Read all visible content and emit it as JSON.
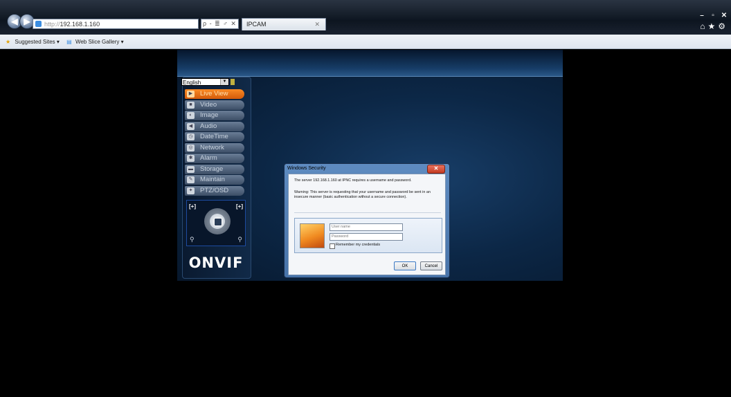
{
  "browser": {
    "address": "http://192.168.1.160",
    "address_protocol": "http://",
    "address_host": "192.168.1.160",
    "address_tools": "ρ - ≣ ♂ ✕",
    "tab_title": "IPCAM",
    "tab_close": "✕",
    "window_controls": [
      "–",
      "▫",
      "✕"
    ],
    "right_tools": "⌂★⚙",
    "favorites": {
      "suggested_sites": "Suggested Sites ▾",
      "web_slice_gallery": "Web Slice Gallery ▾"
    }
  },
  "camera_ui": {
    "language": "English",
    "menu": [
      {
        "label": "Live View",
        "icon": "play-icon",
        "active": true
      },
      {
        "label": "Video",
        "icon": "video-icon",
        "active": false
      },
      {
        "label": "Image",
        "icon": "image-icon",
        "active": false
      },
      {
        "label": "Audio",
        "icon": "speaker-icon",
        "active": false
      },
      {
        "label": "DateTime",
        "icon": "clock-icon",
        "active": false
      },
      {
        "label": "Network",
        "icon": "network-icon",
        "active": false
      },
      {
        "label": "Alarm",
        "icon": "alarm-icon",
        "active": false
      },
      {
        "label": "Storage",
        "icon": "storage-icon",
        "active": false
      },
      {
        "label": "Maintain",
        "icon": "wrench-icon",
        "active": false
      },
      {
        "label": "PTZ/OSD",
        "icon": "ptz-icon",
        "active": false
      }
    ],
    "ptz": {
      "zoom_out": "[+]",
      "zoom_in": "[+]"
    },
    "logo": "ONVIF"
  },
  "dialog": {
    "title": "Windows Security",
    "message": "The server 192.168.1.160 at IPNC requires a username and password.",
    "warning": "Warning: This server is requesting that your username and password be sent in an insecure manner (basic authentication without a secure connection).",
    "username_placeholder": "User name",
    "password_placeholder": "Password",
    "remember_label": "Remember my credentials",
    "ok_label": "OK",
    "cancel_label": "Cancel"
  },
  "colors": {
    "active_menu": "#f07a1a",
    "page_bg": "#0c2746"
  }
}
